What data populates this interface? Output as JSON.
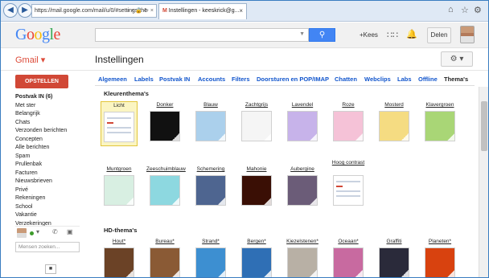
{
  "browser": {
    "address": "https://mail.google.com/mail/u/0/#settings/the",
    "address_icons": "⌕ ▾ 🔒 ↻ ×",
    "tab_label": "Instellingen - keeskrick@g...",
    "tab_close": "×"
  },
  "header": {
    "logo": "Google",
    "search_value": "",
    "account_name": "+Kees",
    "share_label": "Delen"
  },
  "subbar": {
    "app_label": "Gmail ▾",
    "page_title": "Instellingen"
  },
  "sidebar": {
    "compose_label": "OPSTELLEN",
    "items": [
      {
        "label": "Postvak IN (6)",
        "bold": true
      },
      {
        "label": "Met ster"
      },
      {
        "label": "Belangrijk"
      },
      {
        "label": "Chats"
      },
      {
        "label": "Verzonden berichten"
      },
      {
        "label": "Concepten"
      },
      {
        "label": "Alle berichten"
      },
      {
        "label": "Spam"
      },
      {
        "label": "Prullenbak"
      },
      {
        "label": "Facturen"
      },
      {
        "label": "Nieuwsbrieven"
      },
      {
        "label": "Privé"
      },
      {
        "label": "Rekeningen"
      },
      {
        "label": "School"
      },
      {
        "label": "Vakantie"
      },
      {
        "label": "Verzekeringen"
      }
    ],
    "people_search_placeholder": "Mensen zoeken..."
  },
  "settings_tabs": [
    {
      "label": "Algemeen"
    },
    {
      "label": "Labels"
    },
    {
      "label": "Postvak IN"
    },
    {
      "label": "Accounts"
    },
    {
      "label": "Filters"
    },
    {
      "label": "Doorsturen en POP/IMAP"
    },
    {
      "label": "Chatten"
    },
    {
      "label": "Webclips"
    },
    {
      "label": "Labs"
    },
    {
      "label": "Offline"
    },
    {
      "label": "Thema's",
      "active": true
    }
  ],
  "color_themes": {
    "heading": "Kleurenthema's",
    "items": [
      {
        "name": "Licht",
        "color": "#ffffff",
        "selected": true
      },
      {
        "name": "Donker",
        "color": "#111111"
      },
      {
        "name": "Blauw",
        "color": "#abd0ec"
      },
      {
        "name": "Zachtgrijs",
        "color": "#f5f5f5"
      },
      {
        "name": "Lavendel",
        "color": "#c7b3ea"
      },
      {
        "name": "Roze",
        "color": "#f5c2d7"
      },
      {
        "name": "Mosterd",
        "color": "#f5dc82"
      },
      {
        "name": "Klavergroen",
        "color": "#a9d676"
      },
      {
        "name": "Muntgroen",
        "color": "#d8efe2"
      },
      {
        "name": "Zeeschuimblauw",
        "color": "#8dd8e0"
      },
      {
        "name": "Schemering",
        "color": "#4e6590"
      },
      {
        "name": "Mahonie",
        "color": "#3a0f05"
      },
      {
        "name": "Aubergine",
        "color": "#6b5c78"
      },
      {
        "name": "Hoog contrast",
        "color": "#ffffff",
        "contrast": true
      }
    ]
  },
  "hd_themes": {
    "heading": "HD-thema's",
    "items": [
      {
        "name": "Hout*",
        "color": "#6b4226"
      },
      {
        "name": "Bureau*",
        "color": "#8a5a35"
      },
      {
        "name": "Strand*",
        "color": "#3d8fd1"
      },
      {
        "name": "Bergen*",
        "color": "#2f6fb5"
      },
      {
        "name": "Kiezelstenen*",
        "color": "#b8b0a5"
      },
      {
        "name": "Oceaan*",
        "color": "#c86aa0"
      },
      {
        "name": "Graffiti",
        "color": "#2a2a3a"
      },
      {
        "name": "Planeten*",
        "color": "#d8420f"
      }
    ]
  }
}
